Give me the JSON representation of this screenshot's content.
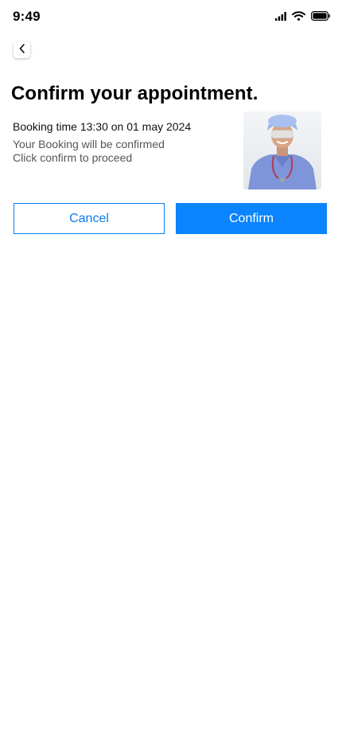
{
  "status_bar": {
    "time": "9:49",
    "icons": [
      "cellular-signal-icon",
      "wifi-icon",
      "battery-icon"
    ]
  },
  "header": {
    "back_icon": "chevron-left-icon"
  },
  "main": {
    "title": "Confirm your appointment.",
    "booking_time": "Booking time 13:30 on 01 may 2024",
    "confirm_note": "Your Booking will be confirmed",
    "proceed_note": "Click confirm to proceed",
    "photo_icon": "doctor-photo"
  },
  "actions": {
    "cancel_label": "Cancel",
    "confirm_label": "Confirm"
  },
  "colors": {
    "accent": "#0a84ff",
    "outline": "#0a7cf0"
  }
}
